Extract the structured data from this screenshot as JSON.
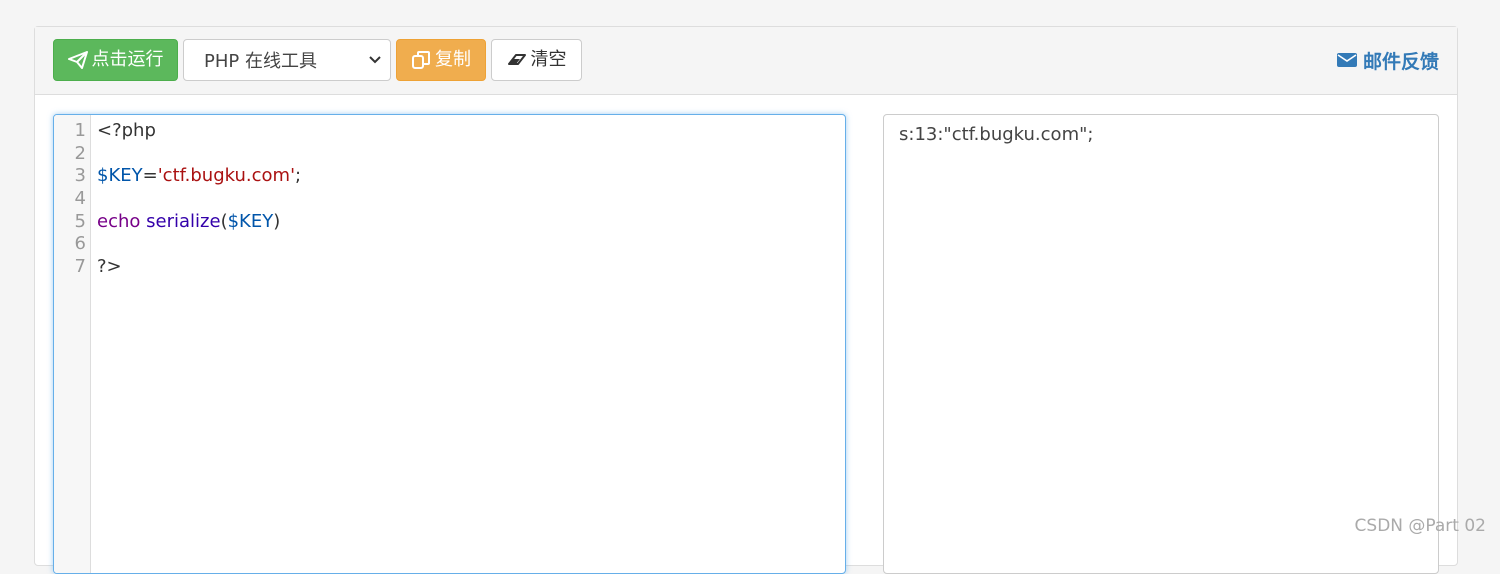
{
  "toolbar": {
    "run_label": "点击运行",
    "language_select": "PHP 在线工具",
    "copy_label": "复制",
    "clear_label": "清空",
    "feedback_label": "邮件反馈"
  },
  "editor": {
    "line_numbers": [
      "1",
      "2",
      "3",
      "4",
      "5",
      "6",
      "7"
    ],
    "lines": {
      "l1": {
        "t1": "<?php"
      },
      "l3": {
        "t1": "$KEY",
        "t2": "=",
        "t3": "'ctf.bugku.com'",
        "t4": ";"
      },
      "l5": {
        "t1": "echo",
        "t2": " ",
        "t3": "serialize",
        "t4": "(",
        "t5": "$KEY",
        "t6": ")"
      },
      "l7": {
        "t1": "?>"
      }
    }
  },
  "output": {
    "text": "s:13:\"ctf.bugku.com\";"
  },
  "watermark": "CSDN @Part 02",
  "colors": {
    "run_button": "#5cb85c",
    "copy_button": "#f0ad4e",
    "link_blue": "#337ab7",
    "variable": "#0055aa",
    "string": "#aa1111",
    "keyword": "#770088"
  },
  "icons": {
    "run": "paper-plane-icon",
    "copy": "copy-icon",
    "clear": "eraser-icon",
    "feedback": "envelope-icon",
    "select": "chevron-down-icon"
  }
}
